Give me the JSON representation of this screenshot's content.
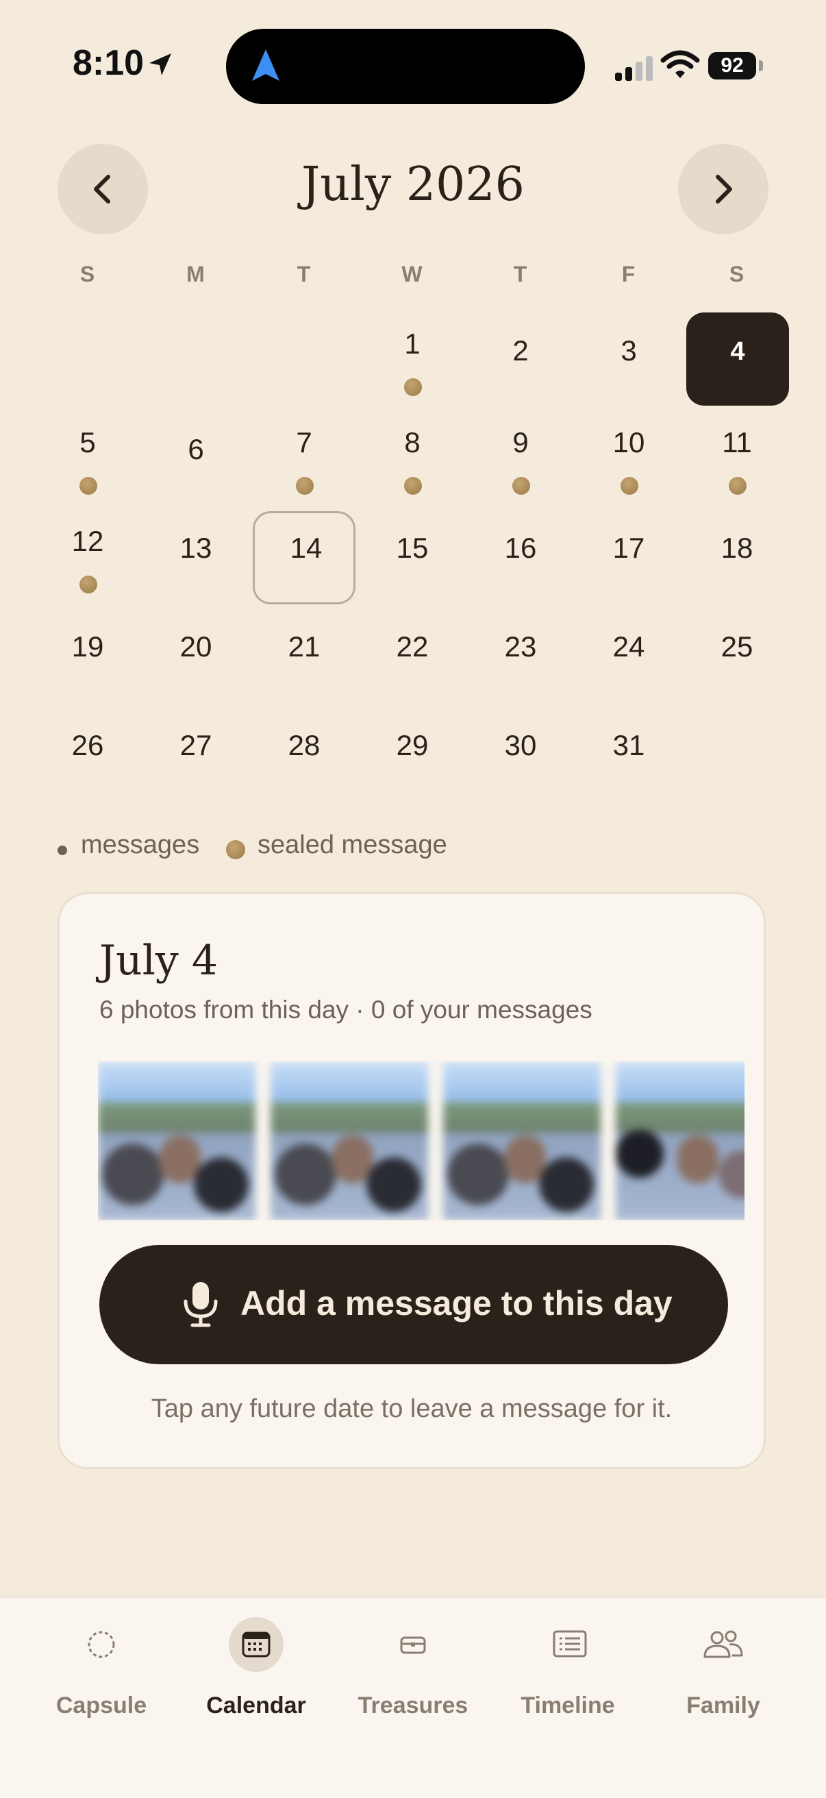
{
  "status_bar": {
    "time": "8:10",
    "battery": "92",
    "icons": [
      "location-arrow-icon",
      "cellular-signal-icon",
      "wifi-icon",
      "battery-icon"
    ]
  },
  "calendar": {
    "month_title": "July 2026",
    "prev_icon": "chevron-left-icon",
    "next_icon": "chevron-right-icon",
    "weekdays": [
      "S",
      "M",
      "T",
      "W",
      "T",
      "F",
      "S"
    ],
    "weeks": [
      [
        null,
        null,
        null,
        {
          "day": "1",
          "dot": true
        },
        {
          "day": "2"
        },
        {
          "day": "3"
        },
        {
          "day": "4",
          "selected": true
        }
      ],
      [
        {
          "day": "5",
          "dot": true
        },
        {
          "day": "6"
        },
        {
          "day": "7",
          "dot": true
        },
        {
          "day": "8",
          "dot": true
        },
        {
          "day": "9",
          "dot": true
        },
        {
          "day": "10",
          "dot": true
        },
        {
          "day": "11",
          "dot": true
        }
      ],
      [
        {
          "day": "12",
          "dot": true
        },
        {
          "day": "13"
        },
        {
          "day": "14",
          "today": true
        },
        {
          "day": "15"
        },
        {
          "day": "16"
        },
        {
          "day": "17"
        },
        {
          "day": "18"
        }
      ],
      [
        {
          "day": "19"
        },
        {
          "day": "20"
        },
        {
          "day": "21"
        },
        {
          "day": "22"
        },
        {
          "day": "23"
        },
        {
          "day": "24"
        },
        {
          "day": "25"
        }
      ],
      [
        {
          "day": "26"
        },
        {
          "day": "27"
        },
        {
          "day": "28"
        },
        {
          "day": "29"
        },
        {
          "day": "30"
        },
        {
          "day": "31"
        },
        null
      ]
    ],
    "accent_dot_color": "#A88A55",
    "selected_color": "#2A211B"
  },
  "legend": {
    "messages": "messages",
    "sealed": "sealed message"
  },
  "day_card": {
    "title": "July 4",
    "subtitle": "6 photos from this day · 0 of your messages",
    "photo_count_visible": 4,
    "add_button_label": "Add a message to this day",
    "add_button_icon": "microphone-icon",
    "hint": "Tap any future date to leave a message for it."
  },
  "tabs": [
    {
      "label": "Capsule",
      "icon": "capsule-circle-icon",
      "active": false
    },
    {
      "label": "Calendar",
      "icon": "calendar-icon",
      "active": true
    },
    {
      "label": "Treasures",
      "icon": "treasure-box-icon",
      "active": false
    },
    {
      "label": "Timeline",
      "icon": "timeline-list-icon",
      "active": false
    },
    {
      "label": "Family",
      "icon": "family-people-icon",
      "active": false
    }
  ]
}
